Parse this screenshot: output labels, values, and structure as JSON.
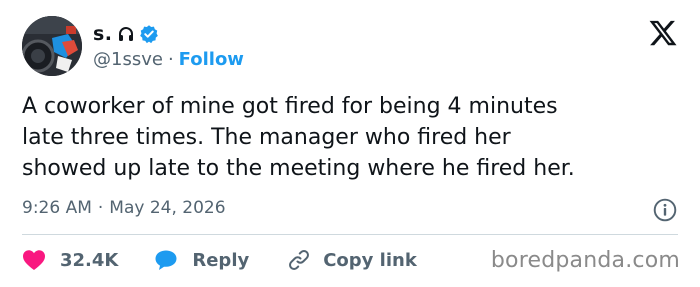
{
  "author": {
    "display_name": "s.",
    "handle": "@1ssve",
    "separator": "·",
    "follow_label": "Follow",
    "accent_color": "#1d9bf0"
  },
  "tweet": {
    "lines": [
      "A coworker of mine got fired for being 4 minutes",
      "late three times. The manager who fired her",
      "showed up late to the meeting where he fired her."
    ],
    "time": "9:26 AM",
    "separator": "·",
    "date": "May 24, 2026"
  },
  "actions": {
    "like_count": "32.4K",
    "reply_label": "Reply",
    "copy_link_label": "Copy link",
    "like_color": "#f91880",
    "reply_color": "#1d9bf0"
  },
  "icons": [
    "headphones-icon",
    "verified-icon",
    "x-logo-icon",
    "info-icon",
    "heart-icon",
    "reply-bubble-icon",
    "link-icon"
  ],
  "watermark": "boredpanda.com"
}
